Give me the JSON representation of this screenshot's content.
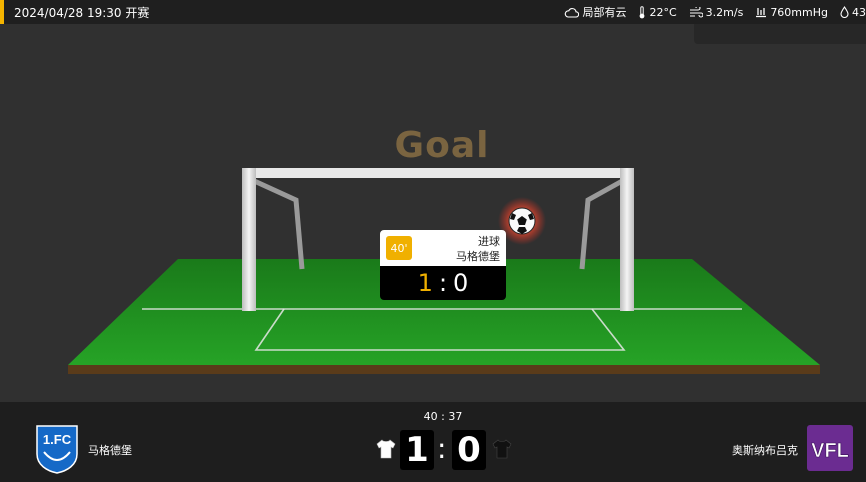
{
  "header": {
    "datetime_status": "2024/04/28 19:30 开赛",
    "weather": {
      "condition": "局部有云",
      "condition_icon": "cloud-icon",
      "temperature": "22°C",
      "temperature_icon": "thermometer-icon",
      "wind": "3.2m/s",
      "wind_icon": "wind-icon",
      "pressure": "760mmHg",
      "pressure_icon": "pressure-icon",
      "humidity": "43",
      "humidity_icon": "droplet-icon"
    }
  },
  "pitch": {
    "event_title": "Goal",
    "ball_icon": "soccer-ball-icon"
  },
  "event_card": {
    "minute": "40'",
    "type": "进球",
    "team": "马格德堡",
    "home_score": "1",
    "separator": ":",
    "away_score": "0"
  },
  "scoreboard": {
    "match_time": "40 : 37",
    "home": {
      "name": "马格德堡",
      "logo_text": "1.FC",
      "score": "1",
      "kit_color": "#ffffff"
    },
    "separator": ":",
    "away": {
      "name": "奥斯纳布吕克",
      "logo_text": "VFL",
      "score": "0",
      "kit_color": "#111111"
    }
  },
  "colors": {
    "accent": "#f5b400",
    "pitch_green": "#1f8a1f",
    "away_purple": "#6b2c91",
    "home_blue": "#1569c7"
  }
}
